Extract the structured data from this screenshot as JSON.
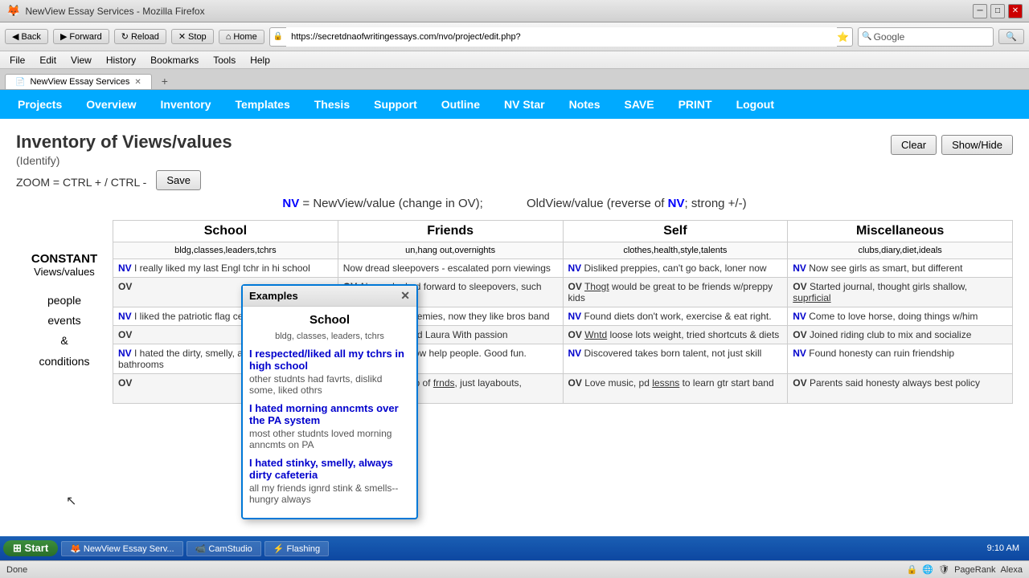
{
  "browser": {
    "title": "NewView Essay Services - Mozilla Firefox",
    "url": "https://secretdnaofwritingessays.com/nvo/project/edit.php?",
    "url_short": "secretdnaofwritingessays.com",
    "tab_label": "NewView Essay Services",
    "google_text": "Google",
    "status": "Done",
    "time": "9:10 AM"
  },
  "menu": {
    "file": "File",
    "edit": "Edit",
    "view": "View",
    "history": "History",
    "bookmarks": "Bookmarks",
    "tools": "Tools",
    "help": "Help"
  },
  "nav": {
    "back": "Back",
    "forward": "Forward",
    "reload": "Reload",
    "stop": "Stop",
    "home": "Home"
  },
  "nav_menu": [
    "Projects",
    "Overview",
    "Inventory",
    "Templates",
    "Thesis",
    "Support",
    "Outline",
    "NV Star",
    "Notes",
    "SAVE",
    "PRINT",
    "Logout"
  ],
  "page": {
    "title": "Inventory of Views/values",
    "subtitle": "(Identify)",
    "zoom_text": "ZOOM = CTRL + / CTRL -",
    "clear_btn": "Clear",
    "showhide_btn": "Show/Hide",
    "save_btn": "Save",
    "nv_eq": "NV = NewView/value (change in OV);",
    "ov_eq": "OV = OldView/value (reverse of NV; strong +/-)"
  },
  "left_panel": {
    "constant": "CONSTANT",
    "views": "Views/values",
    "pec": "people\nevents\n&\nconditions"
  },
  "columns": [
    {
      "header": "School",
      "subheader": "bldg,classes,leaders,tchrs",
      "rows": [
        {
          "nv": "I really liked my last Engl tchr in hi school",
          "ov": ""
        },
        {
          "nv": "I liked the patriotic flag ceremony every day",
          "ov": ""
        },
        {
          "nv": "I hated the dirty, smelly, always messy bathrooms",
          "ov": ""
        }
      ]
    },
    {
      "header": "Friends",
      "subheader": "un,hang out,overnights",
      "rows": [
        {
          "nv": "Now dread sleepovers - escalated porn viewings",
          "ov": "Always looked forward to sleepovers, such fun."
        },
        {
          "nv": "Best friends w/enemies, now they like bros band",
          "ov": "Hated Jen and Laura With passion"
        },
        {
          "nv": "Got civic spirit, now help people. Good fun.",
          "ov": "Felt our group of frnds, just layabouts, worthless"
        }
      ]
    },
    {
      "header": "Self",
      "subheader": "clothes,health,style,talents",
      "rows": [
        {
          "nv": "Disliked preppies, can't go back, loner now",
          "ov": "Thogt would be great to be friends w/preppy kids"
        },
        {
          "nv": "Found diets don't work, exercise & eat right.",
          "ov": "Wntd loose lots weight, tried shortcuts & diets"
        },
        {
          "nv": "Discovered takes born talent, not just skill",
          "ov": "Love music, pd lessns to learn gtr start band"
        }
      ]
    },
    {
      "header": "Miscellaneous",
      "subheader": "clubs,diary,diet,ideals",
      "rows": [
        {
          "nv": "Now see girls as smart, but different",
          "ov": "Started journal, thought girls shallow, suprficial"
        },
        {
          "nv": "Come to love horse, doing things w/him",
          "ov": "Joined riding club to mix and socialize"
        },
        {
          "nv": "Found honesty can ruin friendship",
          "ov": "Parents said honesty always best policy"
        }
      ]
    }
  ],
  "examples_popup": {
    "title": "Examples",
    "col_header": "School",
    "subheader": "bldg, classes, leaders, tchrs",
    "entries": [
      {
        "nv": "I respected/liked all my tchrs in high school",
        "ov": "other studnts had favrts, dislikd some, liked othrs"
      },
      {
        "nv": "I hated morning anncmts over the PA system",
        "ov": "most other studnts loved morning anncmts on PA"
      },
      {
        "nv": "I hated stinky, smelly, always dirty cafeteria",
        "ov": "all my friends ignrd stink & smells--hungry always"
      }
    ]
  },
  "taskbar": {
    "start": "Start",
    "items": [
      "NewView Essay Serv...",
      "CamStudio",
      "Flashing"
    ],
    "pagerank": "PageRank",
    "alexa": "Alexa"
  }
}
